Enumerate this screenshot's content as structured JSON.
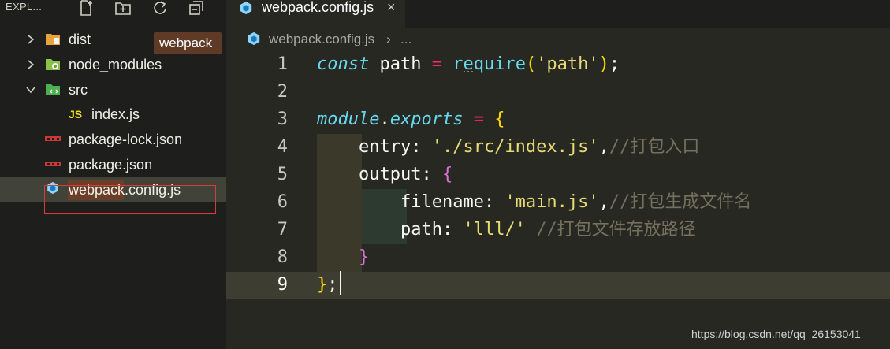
{
  "sidebar": {
    "title": "EXPL...",
    "header_icons": [
      "new-file-icon",
      "new-folder-icon",
      "refresh-icon",
      "collapse-all-icon"
    ],
    "items": [
      {
        "label": "dist",
        "kind": "folder",
        "expanded": false,
        "icon": "folder-dist-icon"
      },
      {
        "label": "node_modules",
        "kind": "folder",
        "expanded": false,
        "icon": "folder-node-icon"
      },
      {
        "label": "src",
        "kind": "folder",
        "expanded": true,
        "icon": "folder-src-icon"
      },
      {
        "label": "index.js",
        "kind": "file",
        "icon": "js-file-icon",
        "badge": "JS"
      },
      {
        "label": "package-lock.json",
        "kind": "file",
        "icon": "npm-file-icon"
      },
      {
        "label": "package.json",
        "kind": "file",
        "icon": "npm-file-icon"
      },
      {
        "label": "webpack.config.js",
        "kind": "file",
        "icon": "webpack-file-icon",
        "selected": true
      }
    ],
    "tooltip": "webpack"
  },
  "editor": {
    "tab": {
      "label": "webpack.config.js",
      "close": "×"
    },
    "breadcrumb": {
      "file": "webpack.config.js",
      "separator": "›",
      "more": "..."
    },
    "current_line": 9,
    "lines": [
      {
        "number": "1",
        "tokens": [
          [
            "kw",
            "const"
          ],
          [
            "id",
            " path "
          ],
          [
            "op",
            "="
          ],
          [
            "id",
            " "
          ],
          [
            "fn",
            "require"
          ],
          [
            "br1",
            "("
          ],
          [
            "str",
            "'path'"
          ],
          [
            "br1",
            ")"
          ],
          [
            "pn",
            ";"
          ]
        ]
      },
      {
        "number": "2",
        "tokens": []
      },
      {
        "number": "3",
        "tokens": [
          [
            "kw",
            "module"
          ],
          [
            "pn",
            "."
          ],
          [
            "kw",
            "exports"
          ],
          [
            "id",
            " "
          ],
          [
            "op",
            "="
          ],
          [
            "id",
            " "
          ],
          [
            "br1",
            "{"
          ]
        ]
      },
      {
        "number": "4",
        "tokens": [
          [
            "id",
            "    "
          ],
          [
            "prop",
            "entry"
          ],
          [
            "pn",
            ": "
          ],
          [
            "str",
            "'./src/index.js'"
          ],
          [
            "pn",
            ","
          ],
          [
            "cm",
            "//打包入口"
          ]
        ]
      },
      {
        "number": "5",
        "tokens": [
          [
            "id",
            "    "
          ],
          [
            "prop",
            "output"
          ],
          [
            "pn",
            ": "
          ],
          [
            "br2",
            "{"
          ]
        ]
      },
      {
        "number": "6",
        "tokens": [
          [
            "id",
            "        "
          ],
          [
            "prop",
            "filename"
          ],
          [
            "pn",
            ": "
          ],
          [
            "str",
            "'main.js'"
          ],
          [
            "pn",
            ","
          ],
          [
            "cm",
            "//打包生成文件名"
          ]
        ]
      },
      {
        "number": "7",
        "tokens": [
          [
            "id",
            "        "
          ],
          [
            "prop",
            "path"
          ],
          [
            "pn",
            ": "
          ],
          [
            "str",
            "'lll/'"
          ],
          [
            "id",
            " "
          ],
          [
            "cm",
            "//打包文件存放路径"
          ]
        ]
      },
      {
        "number": "8",
        "tokens": [
          [
            "id",
            "    "
          ],
          [
            "br2",
            "}"
          ]
        ]
      },
      {
        "number": "9",
        "tokens": [
          [
            "br1",
            "}"
          ],
          [
            "pn",
            ";"
          ]
        ]
      }
    ]
  },
  "watermark": "https://blog.csdn.net/qq_26153041",
  "colors": {
    "editor_bg": "#272822",
    "sidebar_bg": "#1e1f1c",
    "keyword": "#66d9ef",
    "string": "#e6db74",
    "operator": "#f92672",
    "comment": "#75715e",
    "bracket_outer": "#ffd700",
    "bracket_inner": "#da70d6",
    "selection": "#414339",
    "annotation_box": "#d63c3c"
  }
}
